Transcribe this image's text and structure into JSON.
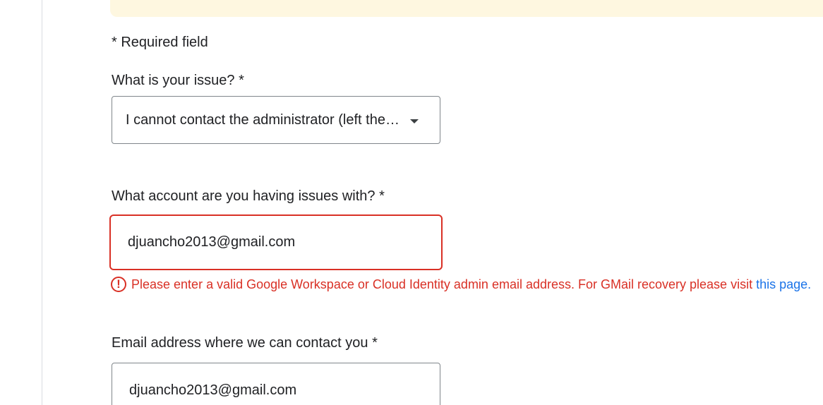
{
  "form": {
    "required_note": "* Required field",
    "issue": {
      "label": "What is your issue? *",
      "selected_value": "I cannot contact the administrator (left the company)"
    },
    "account": {
      "label": "What account are you having issues with? *",
      "value": "djuancho2013@gmail.com",
      "error": {
        "icon": "error-exclamation-icon",
        "message": "Please enter a valid Google Workspace or Cloud Identity admin email address. For GMail recovery please visit",
        "link_text": "this page",
        "trailing": "."
      }
    },
    "contact": {
      "label": "Email address where we can contact you *",
      "value": "djuancho2013@gmail.com"
    }
  },
  "colors": {
    "error": "#d93025",
    "link": "#1a73e8",
    "banner": "#fef7e0",
    "border": "#80868b"
  }
}
